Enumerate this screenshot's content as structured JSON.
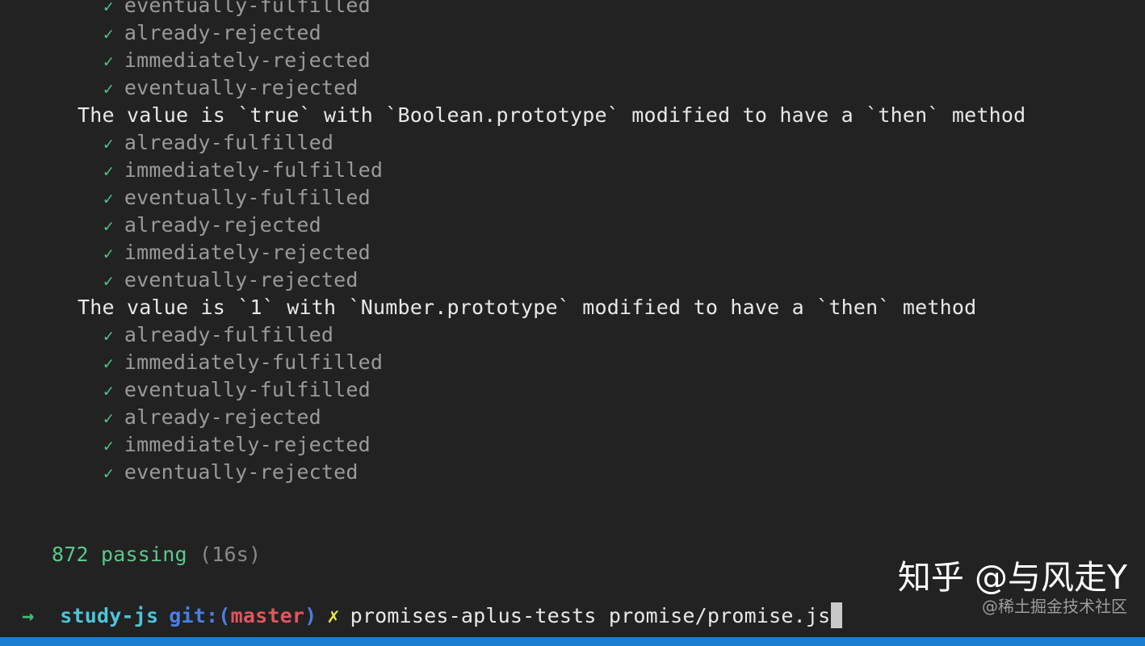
{
  "terminal": {
    "background": "#222222",
    "status_bar_color": "#1a7ed1",
    "lines": [
      {
        "type": "test",
        "check": "✓",
        "label": "eventually-fulfilled"
      },
      {
        "type": "test",
        "check": "✓",
        "label": "already-rejected"
      },
      {
        "type": "test",
        "check": "✓",
        "label": "immediately-rejected"
      },
      {
        "type": "test",
        "check": "✓",
        "label": "eventually-rejected"
      },
      {
        "type": "heading",
        "label": "The value is `true` with `Boolean.prototype` modified to have a `then` method"
      },
      {
        "type": "test",
        "check": "✓",
        "label": "already-fulfilled"
      },
      {
        "type": "test",
        "check": "✓",
        "label": "immediately-fulfilled"
      },
      {
        "type": "test",
        "check": "✓",
        "label": "eventually-fulfilled"
      },
      {
        "type": "test",
        "check": "✓",
        "label": "already-rejected"
      },
      {
        "type": "test",
        "check": "✓",
        "label": "immediately-rejected"
      },
      {
        "type": "test",
        "check": "✓",
        "label": "eventually-rejected"
      },
      {
        "type": "heading",
        "label": "The value is `1` with `Number.prototype` modified to have a `then` method"
      },
      {
        "type": "test",
        "check": "✓",
        "label": "already-fulfilled"
      },
      {
        "type": "test",
        "check": "✓",
        "label": "immediately-fulfilled"
      },
      {
        "type": "test",
        "check": "✓",
        "label": "eventually-fulfilled"
      },
      {
        "type": "test",
        "check": "✓",
        "label": "already-rejected"
      },
      {
        "type": "test",
        "check": "✓",
        "label": "immediately-rejected"
      },
      {
        "type": "test",
        "check": "✓",
        "label": "eventually-rejected"
      },
      {
        "type": "blank",
        "label": " "
      },
      {
        "type": "blank",
        "label": " "
      }
    ],
    "summary": {
      "count": "872",
      "word": "passing",
      "duration": "(16s)",
      "count_color": "#5bc98c",
      "duration_color": "#8a8a8a"
    }
  },
  "prompt": {
    "arrow": "→",
    "directory": "study-js",
    "git_label": "git:",
    "paren_open": "(",
    "branch": "master",
    "paren_close": ")",
    "dirty_marker": "✗",
    "command": "promises-aplus-tests promise/promise.js",
    "arrow_color": "#3fbf6f",
    "directory_color": "#4fc4d6",
    "git_color": "#4a7fe0",
    "branch_color": "#e05561",
    "dirty_color": "#e8e84a"
  },
  "watermark": {
    "main": "知乎 @与风走Y",
    "sub": "@稀土掘金技术社区"
  }
}
